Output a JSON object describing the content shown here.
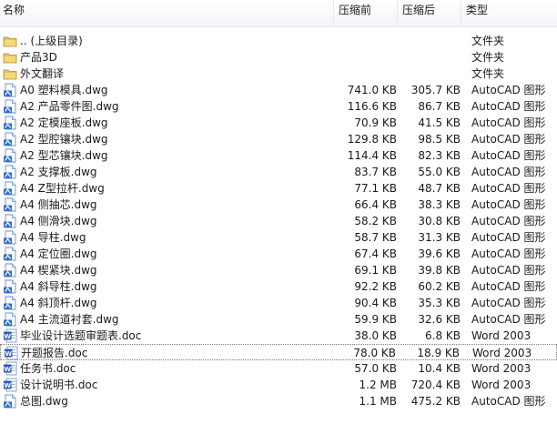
{
  "columns": {
    "name": "名称",
    "original_size": "压缩前",
    "compressed_size": "压缩后",
    "type": "类型"
  },
  "rows": [
    {
      "icon": "folder-icon",
      "name": ".. (上级目录)",
      "original_size": "",
      "compressed_size": "",
      "type": "文件夹"
    },
    {
      "icon": "folder-icon",
      "name": "产品3D",
      "original_size": "",
      "compressed_size": "",
      "type": "文件夹"
    },
    {
      "icon": "folder-icon",
      "name": "外文翻译",
      "original_size": "",
      "compressed_size": "",
      "type": "文件夹"
    },
    {
      "icon": "dwg-file-icon",
      "name": "A0 塑料模具.dwg",
      "original_size": "741.0 KB",
      "compressed_size": "305.7 KB",
      "type": "AutoCAD 图形"
    },
    {
      "icon": "dwg-file-icon",
      "name": "A2 产品零件图.dwg",
      "original_size": "116.6 KB",
      "compressed_size": "86.7 KB",
      "type": "AutoCAD 图形"
    },
    {
      "icon": "dwg-file-icon",
      "name": "A2 定模座板.dwg",
      "original_size": "70.9 KB",
      "compressed_size": "41.5 KB",
      "type": "AutoCAD 图形"
    },
    {
      "icon": "dwg-file-icon",
      "name": "A2 型腔镶块.dwg",
      "original_size": "129.8 KB",
      "compressed_size": "98.5 KB",
      "type": "AutoCAD 图形"
    },
    {
      "icon": "dwg-file-icon",
      "name": "A2 型芯镶块.dwg",
      "original_size": "114.4 KB",
      "compressed_size": "82.3 KB",
      "type": "AutoCAD 图形"
    },
    {
      "icon": "dwg-file-icon",
      "name": "A2 支撑板.dwg",
      "original_size": "83.7 KB",
      "compressed_size": "55.0 KB",
      "type": "AutoCAD 图形"
    },
    {
      "icon": "dwg-file-icon",
      "name": "A4 Z型拉杆.dwg",
      "original_size": "77.1 KB",
      "compressed_size": "48.7 KB",
      "type": "AutoCAD 图形"
    },
    {
      "icon": "dwg-file-icon",
      "name": "A4 侧抽芯.dwg",
      "original_size": "66.4 KB",
      "compressed_size": "38.3 KB",
      "type": "AutoCAD 图形"
    },
    {
      "icon": "dwg-file-icon",
      "name": "A4 侧滑块.dwg",
      "original_size": "58.2 KB",
      "compressed_size": "30.8 KB",
      "type": "AutoCAD 图形"
    },
    {
      "icon": "dwg-file-icon",
      "name": "A4 导柱.dwg",
      "original_size": "58.7 KB",
      "compressed_size": "31.3 KB",
      "type": "AutoCAD 图形"
    },
    {
      "icon": "dwg-file-icon",
      "name": "A4 定位圈.dwg",
      "original_size": "67.4 KB",
      "compressed_size": "39.6 KB",
      "type": "AutoCAD 图形"
    },
    {
      "icon": "dwg-file-icon",
      "name": "A4 楔紧块.dwg",
      "original_size": "69.1 KB",
      "compressed_size": "39.8 KB",
      "type": "AutoCAD 图形"
    },
    {
      "icon": "dwg-file-icon",
      "name": "A4 斜导柱.dwg",
      "original_size": "92.2 KB",
      "compressed_size": "60.2 KB",
      "type": "AutoCAD 图形"
    },
    {
      "icon": "dwg-file-icon",
      "name": "A4 斜顶杆.dwg",
      "original_size": "90.4 KB",
      "compressed_size": "35.3 KB",
      "type": "AutoCAD 图形"
    },
    {
      "icon": "dwg-file-icon",
      "name": "A4 主流道衬套.dwg",
      "original_size": "59.9 KB",
      "compressed_size": "32.6 KB",
      "type": "AutoCAD 图形"
    },
    {
      "icon": "word-doc-icon",
      "name": "毕业设计选题审题表.doc",
      "original_size": "38.0 KB",
      "compressed_size": "6.8 KB",
      "type": "Word 2003"
    },
    {
      "icon": "word-doc-icon",
      "name": "开题报告.doc",
      "original_size": "78.0 KB",
      "compressed_size": "18.9 KB",
      "type": "Word 2003",
      "focused": true
    },
    {
      "icon": "word-doc-icon",
      "name": "任务书.doc",
      "original_size": "57.0 KB",
      "compressed_size": "10.4 KB",
      "type": "Word 2003"
    },
    {
      "icon": "word-doc-icon",
      "name": "设计说明书.doc",
      "original_size": "1.2 MB",
      "compressed_size": "720.4 KB",
      "type": "Word 2003"
    },
    {
      "icon": "dwg-file-icon",
      "name": "总图.dwg",
      "original_size": "1.1 MB",
      "compressed_size": "475.2 KB",
      "type": "AutoCAD 图形"
    }
  ],
  "colors": {
    "folder": "#e8c25a",
    "dwg": "#2f6fc7",
    "word": "#2b5fb4"
  }
}
